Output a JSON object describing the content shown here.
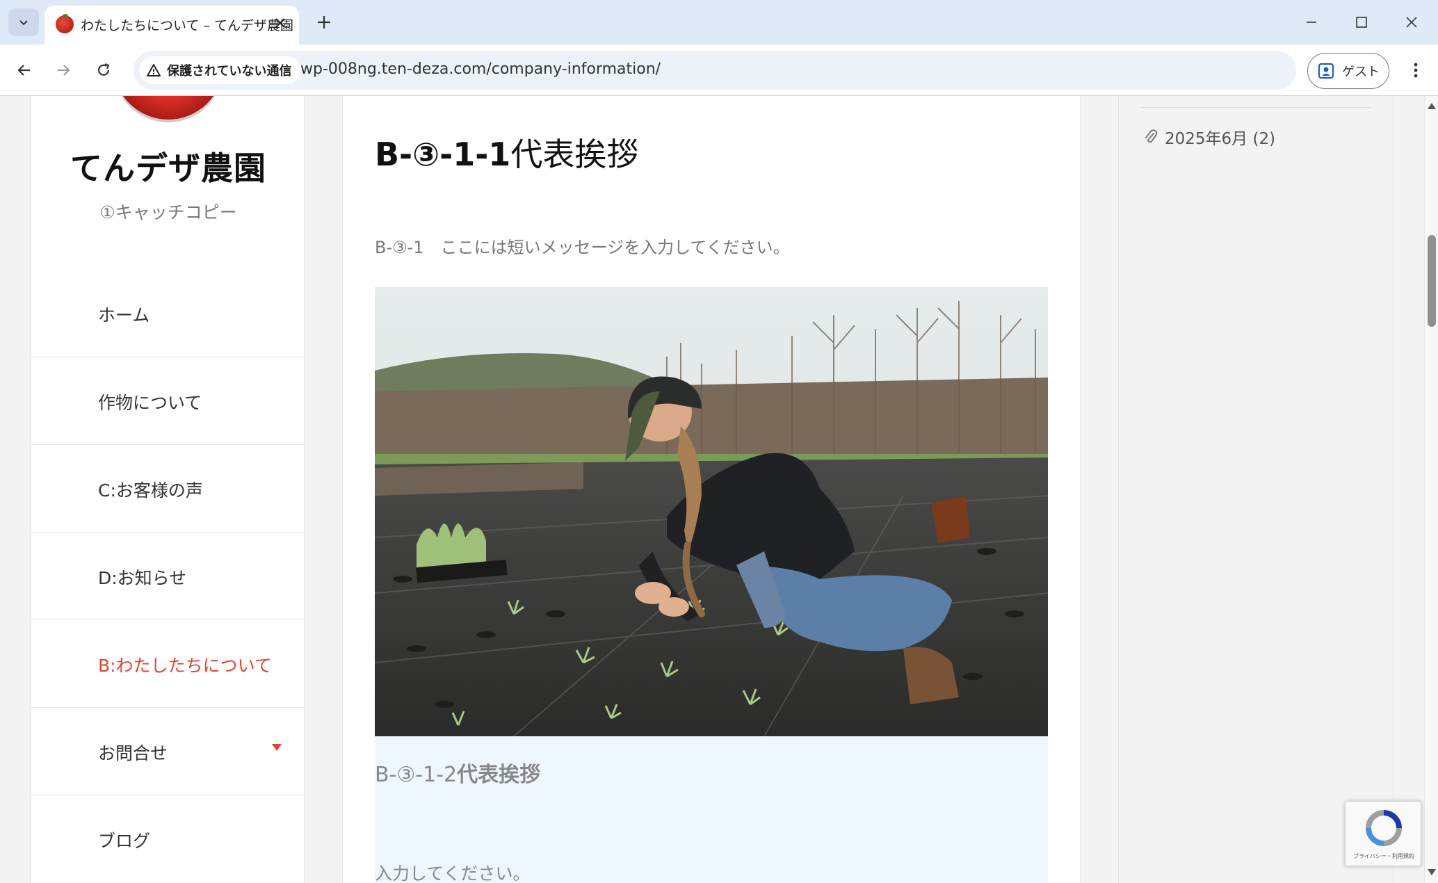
{
  "browser": {
    "tab_title": "わたしたちについて – てんデザ農園",
    "security_label": "保護されていない通信",
    "url": "wp-008ng.ten-deza.com/company-information/",
    "profile_label": "ゲスト"
  },
  "site": {
    "title": "てんデザ農園",
    "catchcopy": "①キャッチコピー"
  },
  "nav": {
    "items": [
      {
        "label": "ホーム"
      },
      {
        "label": "作物について"
      },
      {
        "label": "C:お客様の声"
      },
      {
        "label": "D:お知らせ"
      },
      {
        "label": "B:わたしたちについて"
      },
      {
        "label": "お問合せ"
      },
      {
        "label": "ブログ"
      }
    ]
  },
  "article": {
    "heading1_prefix": "B-③-1-1",
    "heading1_suffix": "代表挨拶",
    "short_message": "B-③-1　ここには短いメッセージを入力してください。",
    "heading2_prefix": "B-③-1-2",
    "heading2_suffix": "代表挨拶",
    "input_text": "入力してください。"
  },
  "widgets": {
    "archive_item": "2025年6月 (2)"
  },
  "recaptcha": {
    "text": "プライバシー・利用規約"
  },
  "colors": {
    "accent": "#e2452f",
    "blue_block": "#eef6fe",
    "tabbar": "#dfe9f8"
  }
}
